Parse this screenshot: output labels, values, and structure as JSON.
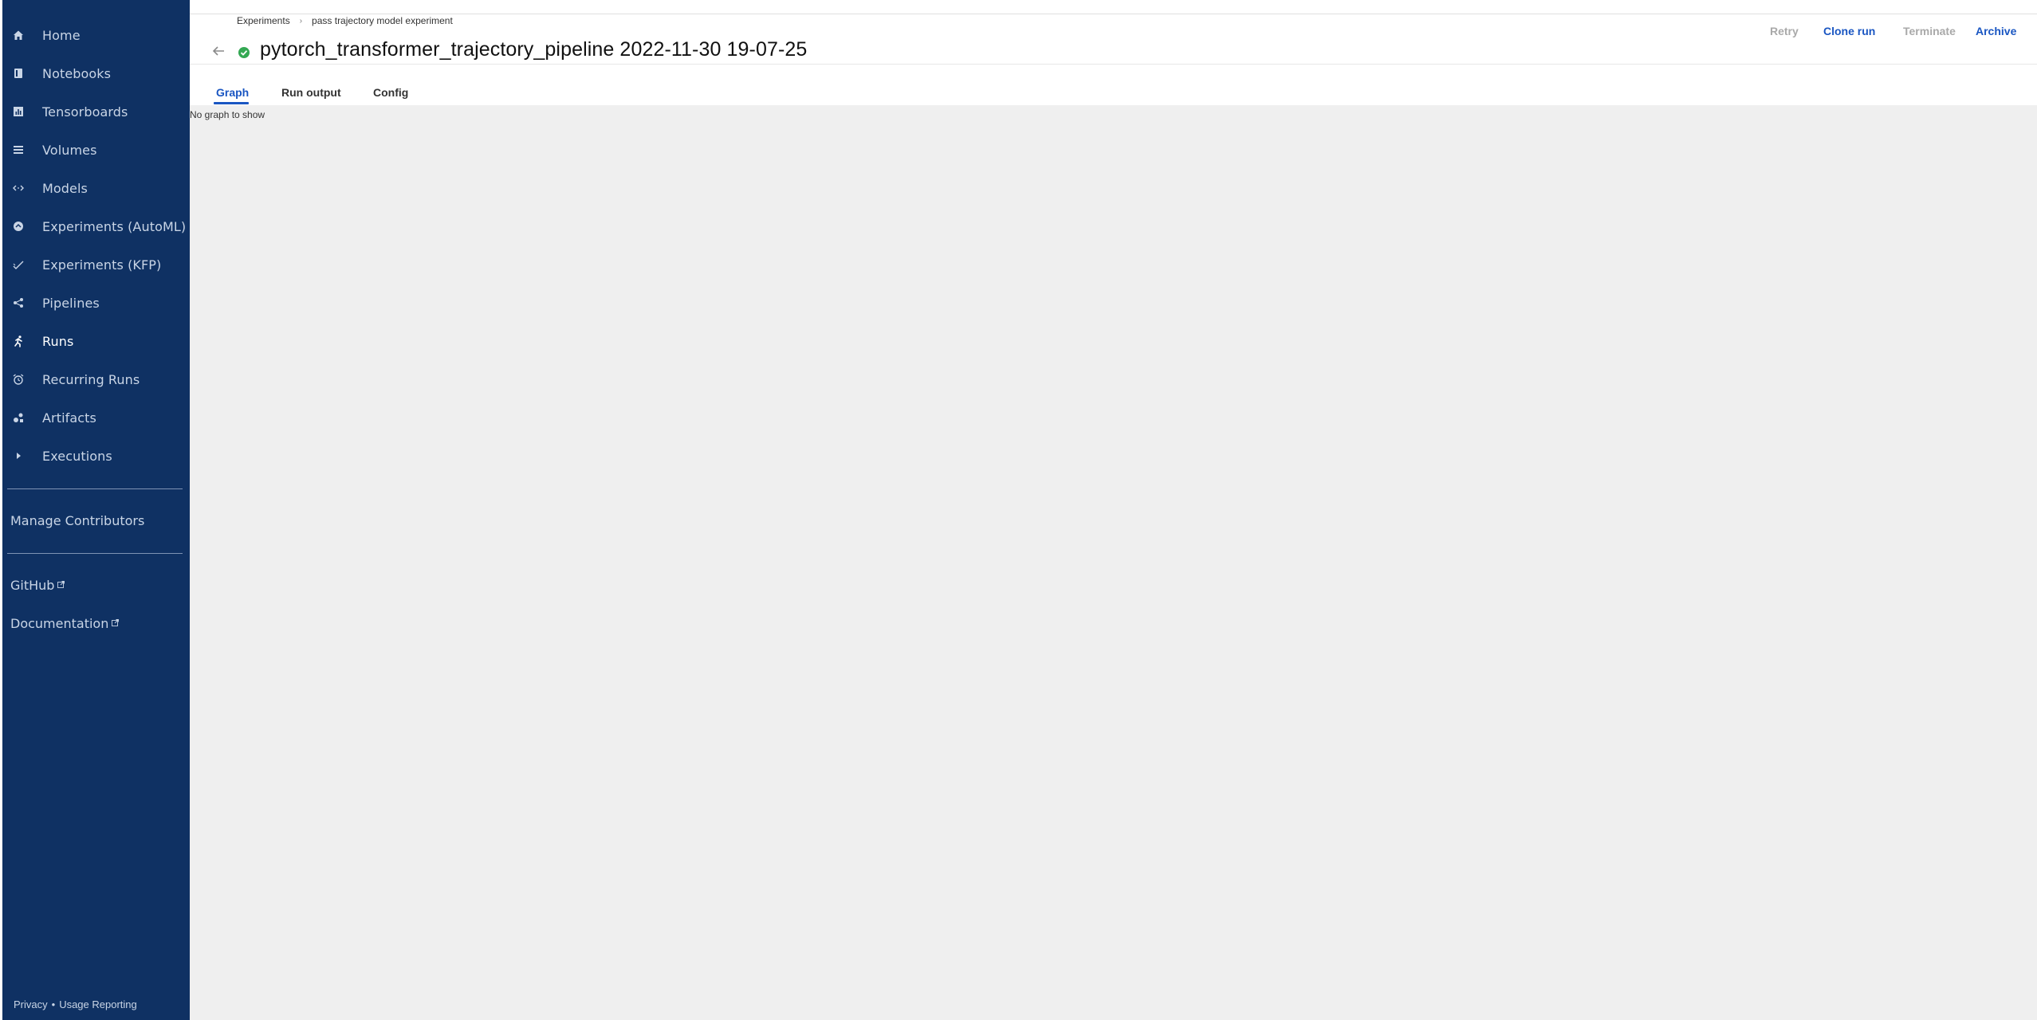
{
  "sidebar": {
    "items": [
      {
        "label": "Home",
        "icon": "home-icon"
      },
      {
        "label": "Notebooks",
        "icon": "notebook-icon"
      },
      {
        "label": "Tensorboards",
        "icon": "tensorboard-icon"
      },
      {
        "label": "Volumes",
        "icon": "volumes-icon"
      },
      {
        "label": "Models",
        "icon": "models-icon"
      },
      {
        "label": "Experiments (AutoML)",
        "icon": "automl-icon"
      },
      {
        "label": "Experiments (KFP)",
        "icon": "kfp-icon"
      },
      {
        "label": "Pipelines",
        "icon": "pipelines-icon"
      },
      {
        "label": "Runs",
        "icon": "runs-icon"
      },
      {
        "label": "Recurring Runs",
        "icon": "alarm-icon"
      },
      {
        "label": "Artifacts",
        "icon": "artifacts-icon"
      },
      {
        "label": "Executions",
        "icon": "play-icon"
      }
    ],
    "active": "Runs",
    "manage_contributors": "Manage Contributors",
    "github": "GitHub",
    "documentation": "Documentation",
    "footer": {
      "privacy": "Privacy",
      "separator": "•",
      "usage": "Usage Reporting"
    }
  },
  "breadcrumb": {
    "root": "Experiments",
    "experiment": "pass trajectory model experiment"
  },
  "run": {
    "title": "pytorch_transformer_trajectory_pipeline 2022-11-30 19-07-25",
    "status": "succeeded"
  },
  "actions": {
    "retry": "Retry",
    "clone": "Clone run",
    "terminate": "Terminate",
    "archive": "Archive"
  },
  "tabs": {
    "graph": "Graph",
    "run_output": "Run output",
    "config": "Config",
    "active": "Graph"
  },
  "graph": {
    "empty_message": "No graph to show"
  },
  "colors": {
    "sidebar_bg": "#0f3163",
    "accent": "#1a56c2",
    "success": "#34a853",
    "graph_bg": "#efefef"
  }
}
